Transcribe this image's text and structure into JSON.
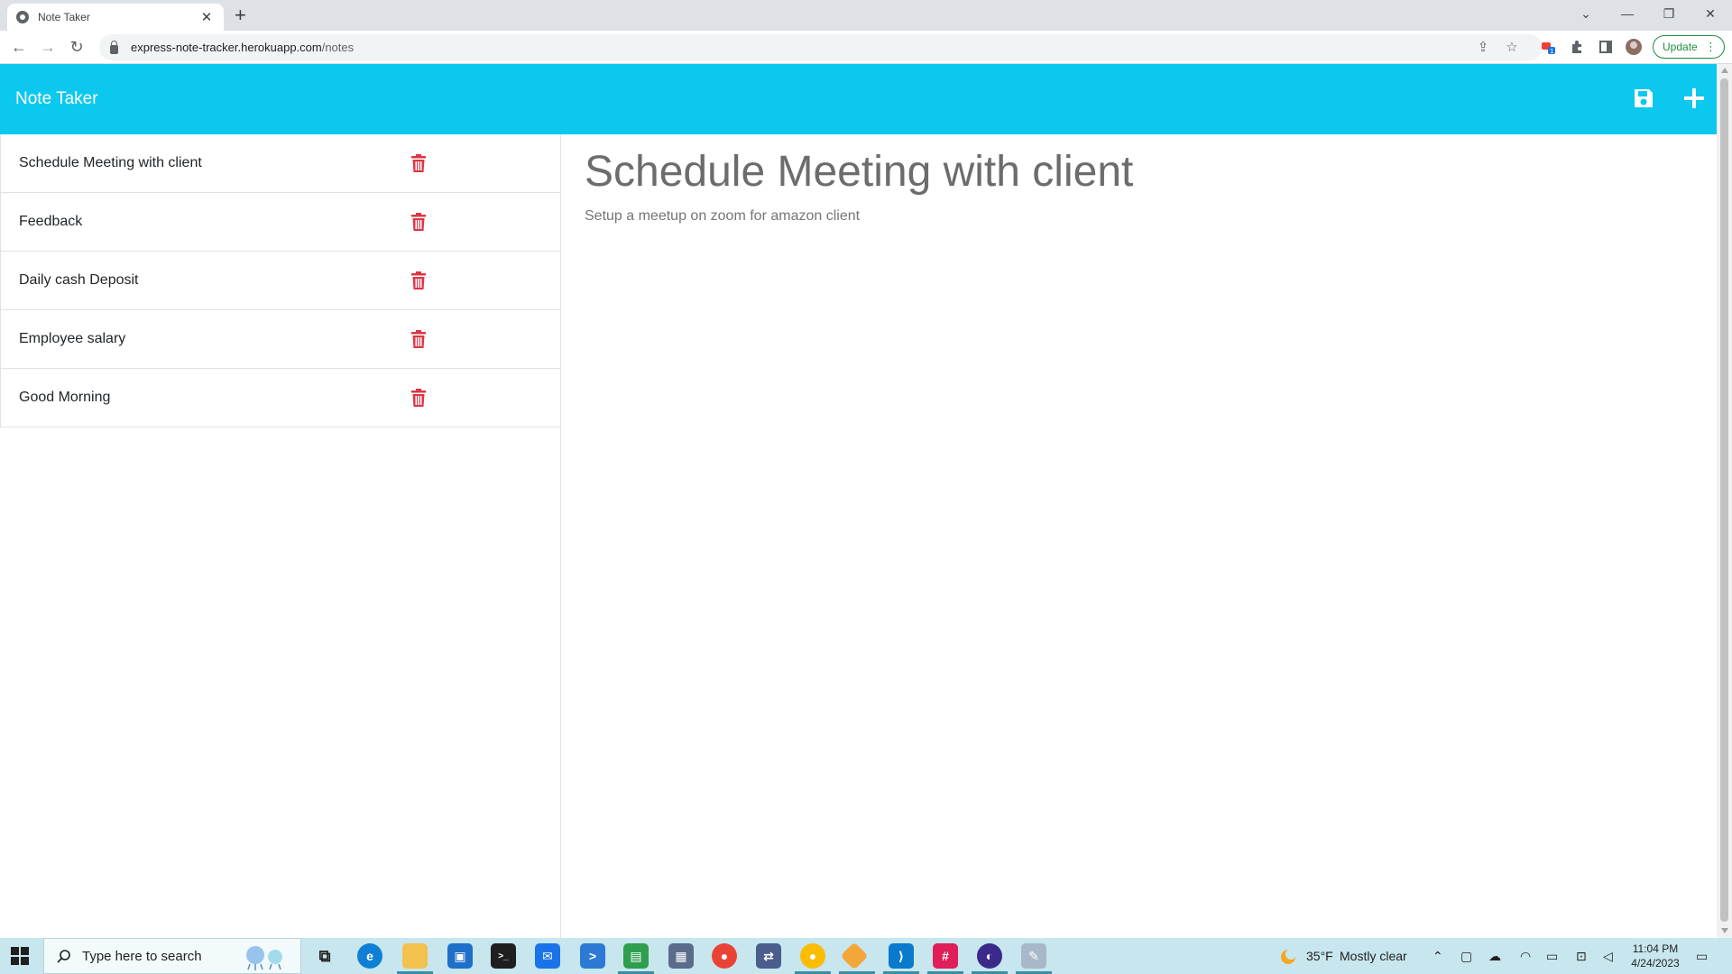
{
  "browser": {
    "tab_title": "Note Taker",
    "url_host": "express-note-tracker.herokuapp.com",
    "url_path": "/notes",
    "update_label": "Update"
  },
  "app": {
    "title": "Note Taker",
    "save_icon": "save-icon",
    "add_icon": "plus-icon"
  },
  "notes": [
    {
      "title": "Schedule Meeting with client"
    },
    {
      "title": "Feedback"
    },
    {
      "title": "Daily cash Deposit"
    },
    {
      "title": "Employee salary"
    },
    {
      "title": "Good Morning"
    }
  ],
  "active_note": {
    "title": "Schedule Meeting with client",
    "text": "Setup a meetup on zoom for amazon client"
  },
  "taskbar": {
    "search_placeholder": "Type here to search",
    "weather_temp": "35°F",
    "weather_text": "Mostly clear",
    "time": "11:04 PM",
    "date": "4/24/2023"
  },
  "colors": {
    "header": "#0cc8ee",
    "trash": "#dc3545"
  }
}
